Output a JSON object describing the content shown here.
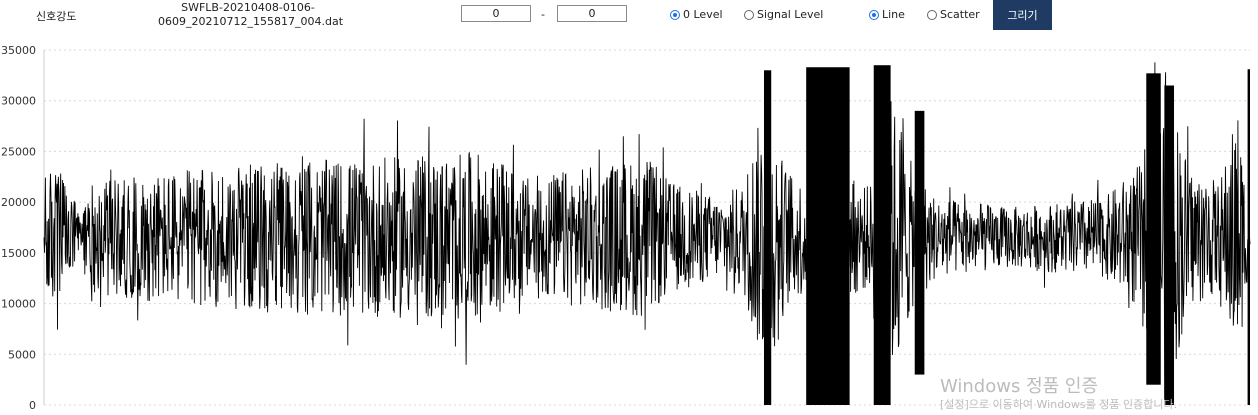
{
  "toolbar": {
    "title": "신호강도",
    "file_line1": "SWFLB-20210408-0106-",
    "file_line2": "0609_20210712_155817_004.dat",
    "range_start": "0",
    "range_separator": "-",
    "range_end": "0",
    "level_options": [
      {
        "label": "0 Level",
        "checked": true
      },
      {
        "label": "Signal Level",
        "checked": false
      }
    ],
    "mode_options": [
      {
        "label": "Line",
        "checked": true
      },
      {
        "label": "Scatter",
        "checked": false
      }
    ],
    "draw_label": "그리기"
  },
  "chart_data": {
    "type": "line",
    "title": "",
    "xlabel": "",
    "ylabel": "",
    "ylim": [
      0,
      35000
    ],
    "y_ticks": [
      0,
      5000,
      10000,
      15000,
      20000,
      25000,
      30000,
      35000
    ],
    "grid": "horizontal-dotted",
    "line_color": "#000000",
    "baseline": 16500,
    "envelope": [
      {
        "x": 0,
        "amp": 6000
      },
      {
        "x": 0.01,
        "amp": 7500
      },
      {
        "x": 0.03,
        "amp": 2500
      },
      {
        "x": 0.04,
        "amp": 5500
      },
      {
        "x": 0.1,
        "amp": 6500
      },
      {
        "x": 0.2,
        "amp": 7500
      },
      {
        "x": 0.3,
        "amp": 8000
      },
      {
        "x": 0.36,
        "amp": 8500
      },
      {
        "x": 0.4,
        "amp": 6000
      },
      {
        "x": 0.5,
        "amp": 8000
      },
      {
        "x": 0.52,
        "amp": 5500
      },
      {
        "x": 0.56,
        "amp": 4000
      },
      {
        "x": 0.58,
        "amp": 5500
      },
      {
        "x": 0.595,
        "amp": 12500
      },
      {
        "x": 0.62,
        "amp": 6000
      },
      {
        "x": 0.648,
        "amp": 6000
      },
      {
        "x": 0.652,
        "amp": 15500
      },
      {
        "x": 0.66,
        "amp": 6500
      },
      {
        "x": 0.685,
        "amp": 5000
      },
      {
        "x": 0.695,
        "amp": 16000
      },
      {
        "x": 0.71,
        "amp": 12000
      },
      {
        "x": 0.72,
        "amp": 7000
      },
      {
        "x": 0.74,
        "amp": 4000
      },
      {
        "x": 0.8,
        "amp": 3000
      },
      {
        "x": 0.88,
        "amp": 4000
      },
      {
        "x": 0.91,
        "amp": 7500
      },
      {
        "x": 0.93,
        "amp": 16500
      },
      {
        "x": 0.95,
        "amp": 7000
      },
      {
        "x": 0.975,
        "amp": 5500
      },
      {
        "x": 0.99,
        "amp": 13000
      },
      {
        "x": 1.0,
        "amp": 1500
      }
    ],
    "bursts": [
      {
        "x_from": 0.597,
        "x_to": 0.603,
        "min": 0,
        "max": 33000
      },
      {
        "x_from": 0.632,
        "x_to": 0.668,
        "min": 0,
        "max": 33300
      },
      {
        "x_from": 0.688,
        "x_to": 0.702,
        "min": 0,
        "max": 33500
      },
      {
        "x_from": 0.722,
        "x_to": 0.73,
        "min": 3000,
        "max": 29000
      },
      {
        "x_from": 0.914,
        "x_to": 0.926,
        "min": 2000,
        "max": 32700
      },
      {
        "x_from": 0.929,
        "x_to": 0.937,
        "min": 0,
        "max": 31500
      },
      {
        "x_from": 0.998,
        "x_to": 1.01,
        "min": 0,
        "max": 33100
      }
    ]
  },
  "watermark": {
    "title": "Windows 정품 인증",
    "subtitle": "[설정]으로 이동하여 Windows를 정품 인증합니다."
  }
}
